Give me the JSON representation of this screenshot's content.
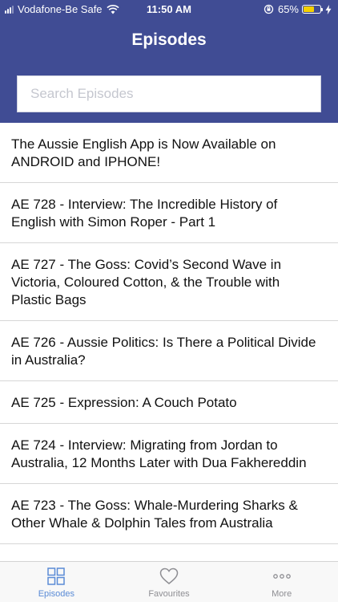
{
  "status_bar": {
    "carrier": "Vodafone-Be Safe",
    "time": "11:50 AM",
    "battery_percent": "65%",
    "battery_level": 0.65
  },
  "header": {
    "title": "Episodes",
    "background": "#404c94"
  },
  "search": {
    "placeholder": "Search Episodes",
    "value": ""
  },
  "episodes": [
    "The Aussie English App is Now Available on ANDROID and IPHONE!",
    "AE 728 - Interview: The Incredible History of English with Simon Roper - Part 1",
    "AE 727 - The Goss: Covid’s Second Wave in Victoria, Coloured Cotton, & the Trouble with Plastic Bags",
    "AE 726 - Aussie Politics: Is There a Political Divide in Australia?",
    "AE 725 - Expression: A Couch Potato",
    "AE 724 - Interview: Migrating from Jordan to Australia, 12 Months Later with Dua Fakhereddin",
    "AE 723 - The Goss: Whale-Murdering Sharks & Other Whale & Dolphin Tales from Australia"
  ],
  "tabs": [
    {
      "label": "Episodes",
      "icon": "grid-icon",
      "active": true
    },
    {
      "label": "Favourites",
      "icon": "heart-icon",
      "active": false
    },
    {
      "label": "More",
      "icon": "more-icon",
      "active": false
    }
  ],
  "colors": {
    "accent": "#5a8bd6",
    "inactive": "#8e8e93",
    "battery": "#f5d000"
  }
}
